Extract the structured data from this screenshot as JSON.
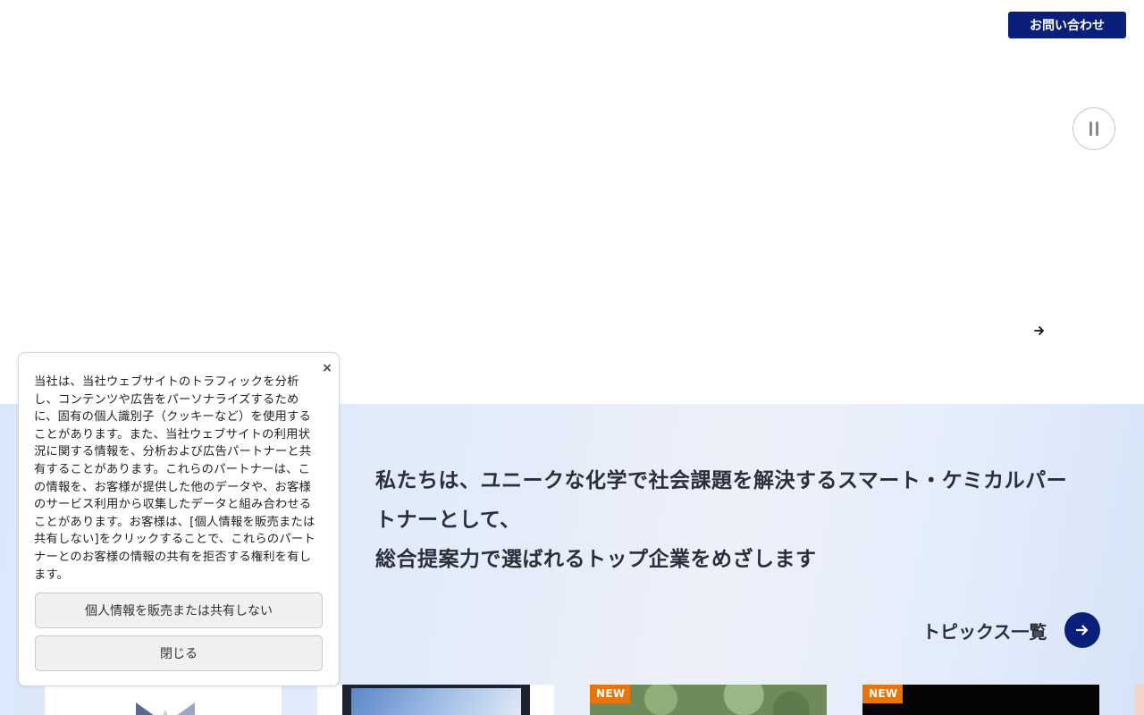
{
  "header": {
    "contact_label": "お問い合わせ"
  },
  "hero": {
    "pause_icon": "pause-icon",
    "next_icon": "arrow-right-icon"
  },
  "mission": {
    "lines": [
      "私たちは、ユニークな化学で社会課題を解決するスマート・ケミカルパー",
      "トナーとして、",
      "総合提案力で選ばれるトップ企業をめざします"
    ]
  },
  "topics": {
    "label": "トピックス一覧",
    "icon": "arrow-right-icon"
  },
  "cards": [
    {
      "badge": ""
    },
    {
      "badge": ""
    },
    {
      "badge": "NEW"
    },
    {
      "badge": "NEW"
    }
  ],
  "cookie_dialog": {
    "close_symbol": "×",
    "lines": [
      "当社は、当社ウェブサイトのトラフィックを分析",
      "し、コンテンツや広告をパーソナライズするため",
      "に、固有の個人識別子（クッキーなど）を使用する",
      "ことがあります。また、当社ウェブサイトの利用状",
      "況に関する情報を、分析および広告パートナーと共",
      "有することがあります。これらのパートナーは、こ",
      "の情報を、お客様が提供した他のデータや、お客様",
      "のサービス利用から収集したデータと組み合わせる",
      "ことがあります。お客様は、[個人情報を販売または",
      "共有しない]をクリックすることで、これらのパート",
      "ナーとのお客様の情報の共有を拒否する権利を有し",
      "ます。"
    ],
    "optout_label": "個人情報を販売または共有しない",
    "close_label": "閉じる"
  },
  "colors": {
    "brand_navy": "#0a1f7a",
    "new_badge": "#e8740c"
  }
}
